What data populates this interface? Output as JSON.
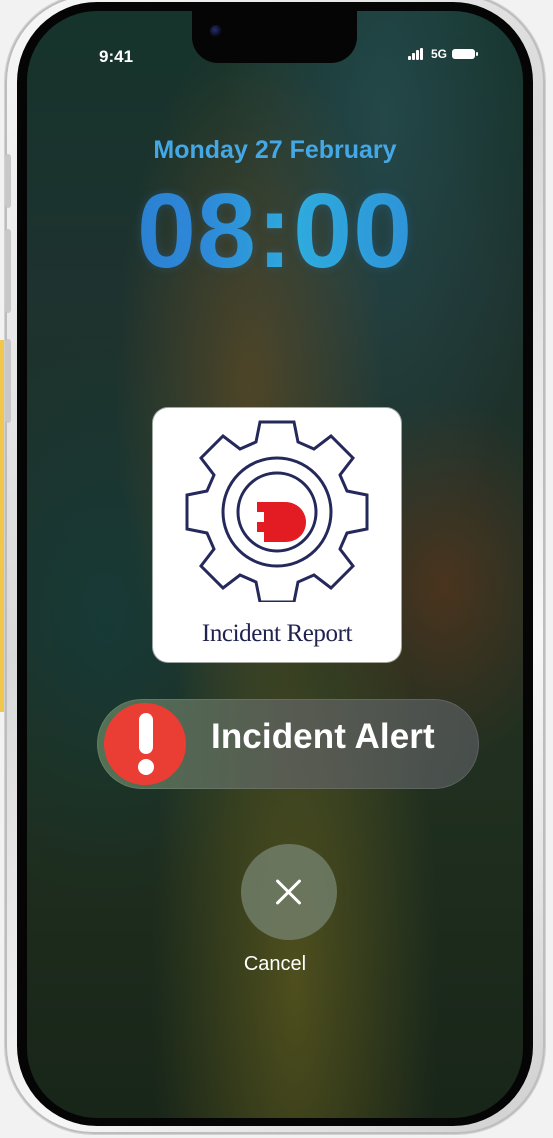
{
  "status_bar": {
    "time": "9:41",
    "network": "5G"
  },
  "lock_screen": {
    "date": "Monday 27 February",
    "time": "08:00"
  },
  "app": {
    "name": "Incident Report",
    "icon_name": "gear-icon"
  },
  "alert": {
    "label": "Incident Alert",
    "icon_name": "exclamation-icon",
    "accent_color": "#ea3e35"
  },
  "cancel": {
    "label": "Cancel",
    "icon_name": "close-icon"
  },
  "colors": {
    "date_text": "#44a8e6",
    "clock_blue": "#2f8ad8",
    "app_title": "#20224f",
    "app_accent": "#e31b23"
  }
}
